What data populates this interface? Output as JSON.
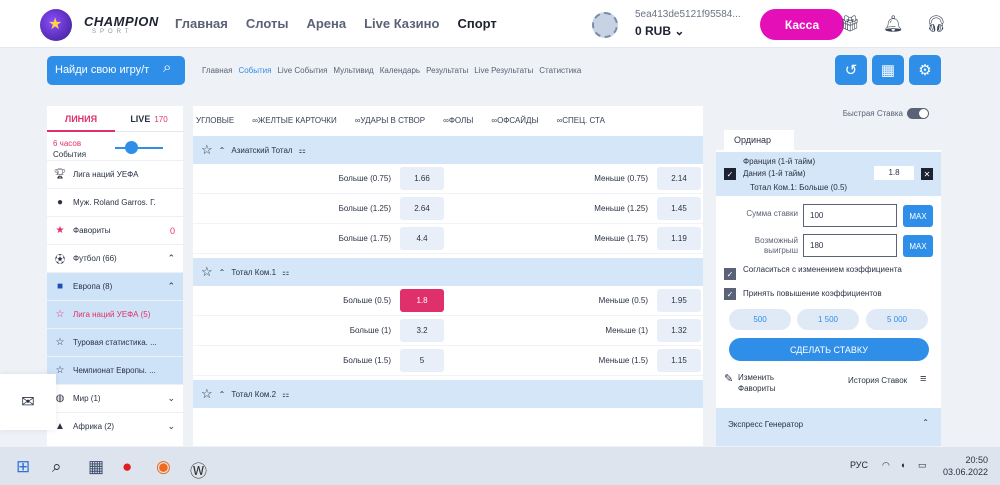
{
  "header": {
    "brand": "CHAMPION",
    "brand_sub": "SPORT",
    "nav": [
      "Главная",
      "Слоты",
      "Арена",
      "Live Казино",
      "Спорт"
    ],
    "account_id": "5ea413de5121f95584...",
    "balance": "0 RUB",
    "kassa": "Касса"
  },
  "subbar": {
    "search_placeholder": "Найди свою игру/т",
    "links": [
      "Главная",
      "События",
      "Live События",
      "Мультивид",
      "Календарь",
      "Результаты",
      "Live Результаты",
      "Статистика"
    ]
  },
  "left": {
    "tab_line": "ЛИНИЯ",
    "tab_live": "LIVE",
    "live_count": "170",
    "time_value": "6 часов",
    "time_label": "События",
    "items": [
      {
        "label": "Лига наций УЕФА",
        "icon": "trophy-icon"
      },
      {
        "label": "Муж. Roland Garros. Г.",
        "icon": "tennis-icon"
      },
      {
        "label": "Фавориты",
        "icon": "star-icon",
        "right": "0"
      },
      {
        "label": "Футбол (66)",
        "icon": "soccer-ball-icon",
        "right": "⌃"
      },
      {
        "label": "Европа (8)",
        "icon": "eu-flag-icon",
        "right": "⌃"
      },
      {
        "label": "Лига наций УЕФА (5)",
        "icon": "star-icon"
      },
      {
        "label": "Туровая статистика. ...",
        "icon": "star-icon"
      },
      {
        "label": "Чемпионат Европы. ...",
        "icon": "star-icon"
      },
      {
        "label": "Мир (1)",
        "icon": "globe-icon",
        "right": "⌄"
      },
      {
        "label": "Африка (2)",
        "icon": "africa-icon",
        "right": "⌄"
      }
    ]
  },
  "center": {
    "categories": [
      "УГЛОВЫЕ",
      "ЖЕЛТЫЕ КАРТОЧКИ",
      "УДАРЫ В СТВОР",
      "ФОЛЫ",
      "ОФСАЙДЫ",
      "СПЕЦ. СТА"
    ],
    "blocks": [
      {
        "title": "Азиатский Тотал",
        "rows": [
          {
            "l_label": "Больше (0.75)",
            "l_odd": "1.66",
            "r_label": "Меньше (0.75)",
            "r_odd": "2.14"
          },
          {
            "l_label": "Больше (1.25)",
            "l_odd": "2.64",
            "r_label": "Меньше (1.25)",
            "r_odd": "1.45"
          },
          {
            "l_label": "Больше (1.75)",
            "l_odd": "4.4",
            "r_label": "Меньше (1.75)",
            "r_odd": "1.19"
          }
        ]
      },
      {
        "title": "Тотал Ком.1",
        "rows": [
          {
            "l_label": "Больше (0.5)",
            "l_odd": "1.8",
            "r_label": "Меньше (0.5)",
            "r_odd": "1.95"
          },
          {
            "l_label": "Больше (1)",
            "l_odd": "3.2",
            "r_label": "Меньше (1)",
            "r_odd": "1.32"
          },
          {
            "l_label": "Больше (1.5)",
            "l_odd": "5",
            "r_label": "Меньше (1.5)",
            "r_odd": "1.15"
          }
        ]
      },
      {
        "title": "Тотал Ком.2",
        "rows": []
      }
    ]
  },
  "slip": {
    "quick_bet": "Быстрая Ставка",
    "tab": "Ординар",
    "match_line1": "Франция (1-й тайм)",
    "match_line2": "Дания (1-й тайм)",
    "odd": "1.8",
    "selection": "Тотал Ком.1: Больше (0.5)",
    "stake_label": "Сумма ставки",
    "stake_value": "100",
    "win_label": "Возможный выигрыш",
    "win_value": "180",
    "max": "MAX",
    "agree_change": "Согласиться с изменением коэффициента",
    "accept_increase": "Принять повышение коэффициентов",
    "amounts": [
      "500",
      "1 500",
      "5 000"
    ],
    "make_bet": "СДЕЛАТЬ СТАВКУ",
    "edit_favorites": "Изменить Фавориты",
    "history": "История Ставок",
    "express": "Экспресс Генератор"
  },
  "taskbar": {
    "lang": "РУС",
    "time": "20:50",
    "date": "03.06.2022"
  }
}
